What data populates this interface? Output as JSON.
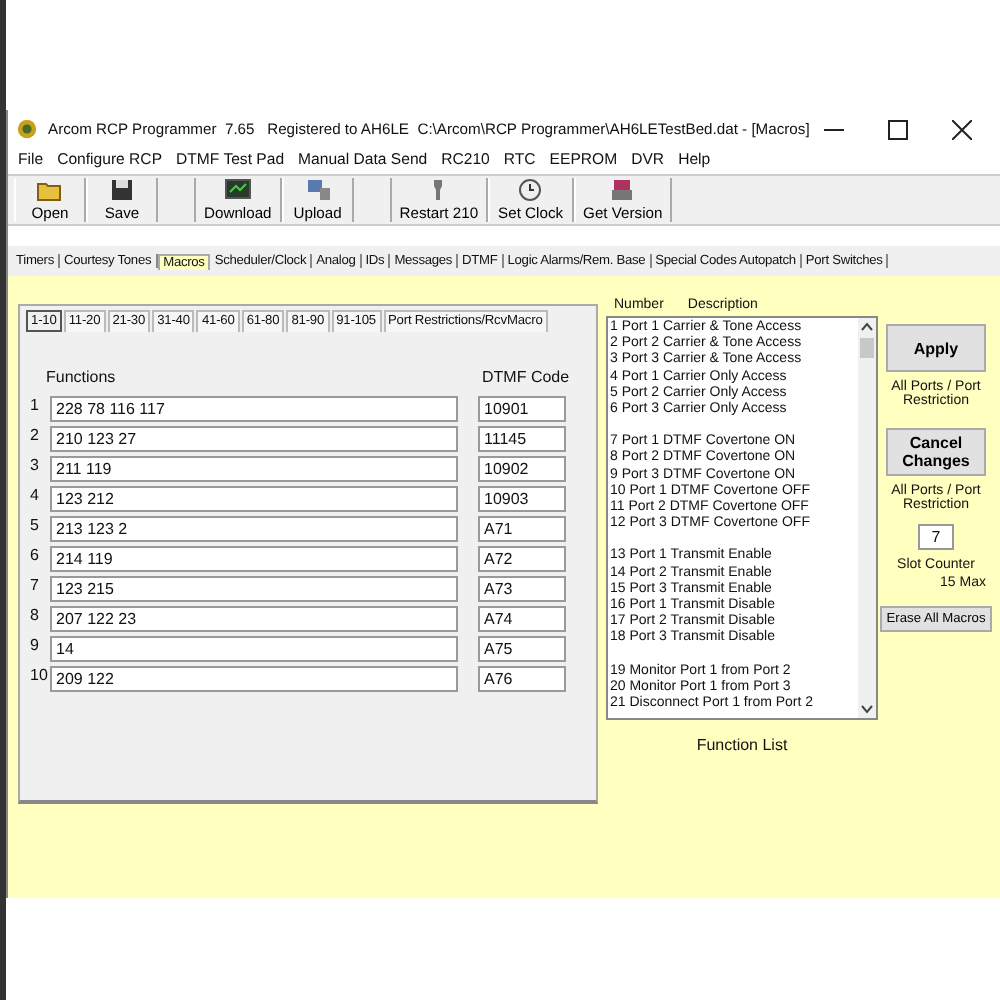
{
  "window": {
    "title": "Arcom RCP Programmer  7.65   Registered to AH6LE  C:\\Arcom\\RCP Programmer\\AH6LETestBed.dat - [Macros]"
  },
  "menu": [
    "File",
    "Configure RCP",
    "DTMF Test Pad",
    "Manual Data Send",
    "RC210",
    "RTC",
    "EEPROM",
    "DVR",
    "Help"
  ],
  "toolbar": [
    {
      "label": "Open",
      "kind": "open",
      "gap_before": false
    },
    {
      "label": "Save",
      "kind": "save",
      "gap_before": false
    },
    {
      "label": "Download",
      "kind": "download",
      "gap_before": true
    },
    {
      "label": "Upload",
      "kind": "upload",
      "gap_before": false
    },
    {
      "label": "Restart 210",
      "kind": "restart",
      "gap_before": true
    },
    {
      "label": "Set Clock",
      "kind": "clock",
      "gap_before": false
    },
    {
      "label": "Get Version",
      "kind": "version",
      "gap_before": false
    }
  ],
  "tabs": [
    {
      "label": "Timers",
      "selected": false
    },
    {
      "label": "Courtesy Tones",
      "selected": false
    },
    {
      "label": "Macros",
      "selected": true
    },
    {
      "label": "Scheduler/Clock",
      "selected": false
    },
    {
      "label": "Analog",
      "selected": false
    },
    {
      "label": "IDs",
      "selected": false
    },
    {
      "label": "Messages",
      "selected": false
    },
    {
      "label": "DTMF",
      "selected": false
    },
    {
      "label": "Logic Alarms/Rem. Base",
      "selected": false
    },
    {
      "label": "Special Codes Autopatch",
      "selected": false
    },
    {
      "label": "Port Switches",
      "selected": false
    }
  ],
  "subtabs": [
    {
      "label": "1-10",
      "selected": true
    },
    {
      "label": "11-20",
      "selected": false
    },
    {
      "label": "21-30",
      "selected": false
    },
    {
      "label": "31-40",
      "selected": false
    },
    {
      "label": "41-60",
      "selected": false
    },
    {
      "label": "61-80",
      "selected": false
    },
    {
      "label": "81-90",
      "selected": false
    },
    {
      "label": "91-105",
      "selected": false
    },
    {
      "label": "Port Restrictions/RcvMacro",
      "selected": false
    }
  ],
  "macros": {
    "functions_label": "Functions",
    "code_label": "DTMF Code",
    "rows": [
      {
        "number": "1",
        "functions": "228 78 116 117",
        "code": "10901"
      },
      {
        "number": "2",
        "functions": "210 123 27",
        "code": "11145"
      },
      {
        "number": "3",
        "functions": "211 119",
        "code": "10902"
      },
      {
        "number": "4",
        "functions": "123 212",
        "code": "10903"
      },
      {
        "number": "5",
        "functions": "213 123 2",
        "code": "A71"
      },
      {
        "number": "6",
        "functions": "214 119",
        "code": "A72"
      },
      {
        "number": "7",
        "functions": "123 215",
        "code": "A73"
      },
      {
        "number": "8",
        "functions": "207 122 23",
        "code": "A74"
      },
      {
        "number": "9",
        "functions": "14",
        "code": "A75"
      },
      {
        "number": "10",
        "functions": "209 122",
        "code": "A76"
      }
    ]
  },
  "function_list": {
    "number_header": "Number",
    "description_header": "Description",
    "caption": "Function List",
    "groups": [
      [
        "1 Port 1 Carrier & Tone Access",
        "2 Port 2 Carrier & Tone  Access",
        "3 Port 3 Carrier & Tone  Access",
        "4 Port 1 Carrier Only Access",
        "5 Port 2 Carrier Only Access",
        "6 Port 3 Carrier Only Access"
      ],
      [
        "7 Port 1 DTMF Covertone ON",
        "8 Port 2 DTMF Covertone ON",
        "9 Port 3 DTMF Covertone ON",
        "10 Port 1 DTMF Covertone OFF",
        "11 Port 2 DTMF Covertone OFF",
        "12 Port 3 DTMF Covertone OFF"
      ],
      [
        "13 Port 1 Transmit Enable",
        "14 Port 2 Transmit Enable",
        "15 Port 3 Transmit Enable",
        "16 Port 1 Transmit Disable",
        "17 Port 2 Transmit Disable",
        "18 Port 3 Transmit Disable"
      ],
      [
        "19 Monitor Port 1 from Port 2",
        "20 Monitor Port 1 from Port 3",
        "21 Disconnect Port 1 from Port 2"
      ]
    ]
  },
  "side": {
    "apply": "Apply",
    "apply_note": "All Ports / Port Restriction",
    "cancel": "Cancel Changes",
    "cancel_note": "All Ports / Port Restriction",
    "slot_value": "7",
    "slot_label": "Slot Counter",
    "slot_max": "15 Max",
    "erase": "Erase All Macros"
  }
}
